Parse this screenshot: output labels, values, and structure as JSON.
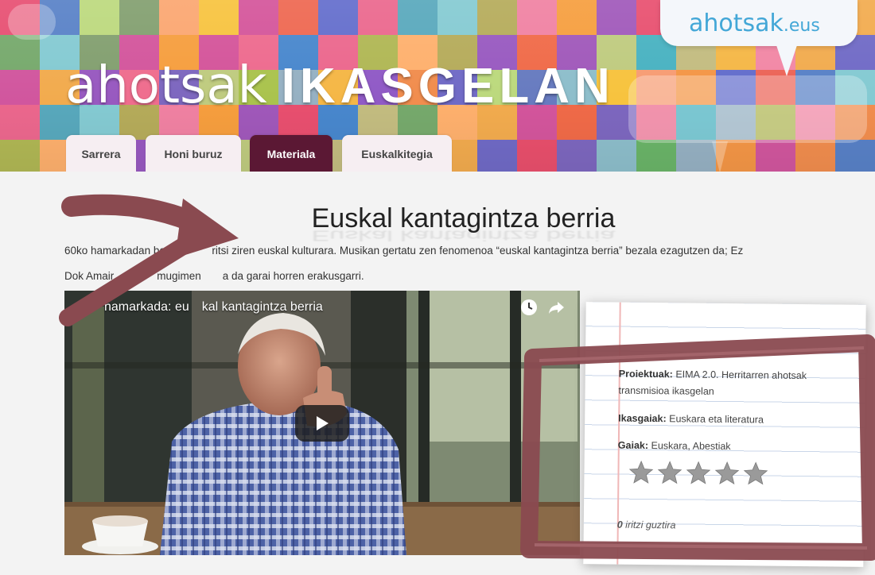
{
  "header": {
    "logo_part1": "ahotsak",
    "logo_part2": "IKASGELAN",
    "site_badge_main": "ahotsak",
    "site_badge_tld": ".eus"
  },
  "tabs": [
    {
      "label": "Sarrera",
      "active": false
    },
    {
      "label": "Honi buruz",
      "active": false
    },
    {
      "label": "Materiala",
      "active": true
    },
    {
      "label": "Euskalkitegia",
      "active": false
    }
  ],
  "main": {
    "title": "Euskal kantagintza berria",
    "intro_line1": "60ko hamarkadan ber    ritsi ziren euskal kulturara. Musikan gertatu zen fenomenoa “euskal kantagintza berria” bezala ezagutzen da; Ez",
    "intro_line2": "Dok Amair    mugimen  a da garai horren erakusgarri."
  },
  "video": {
    "title": " hamarkada: eu kal kantagintza berria",
    "icons": [
      "clock-icon",
      "share-icon",
      "play-icon"
    ]
  },
  "card": {
    "projects_label": "Proiektuak:",
    "projects_value_line1": " EIMA 2.0. Herritarren ahotsak",
    "projects_value_line2": "transmisioa ikasgelan",
    "subjects_label": "Ikasgaiak:",
    "subjects_value": " Euskara eta literatura",
    "topics_label": "Gaiak:",
    "topics_value": " Euskara, Abestiak",
    "rating": 0,
    "max_rating": 5,
    "votes_count": "0",
    "votes_text": " iritzi guztira"
  },
  "colors": {
    "active_tab": "#5b1834",
    "annotation": "#8a4a50",
    "link_blue": "#43a7d7"
  }
}
